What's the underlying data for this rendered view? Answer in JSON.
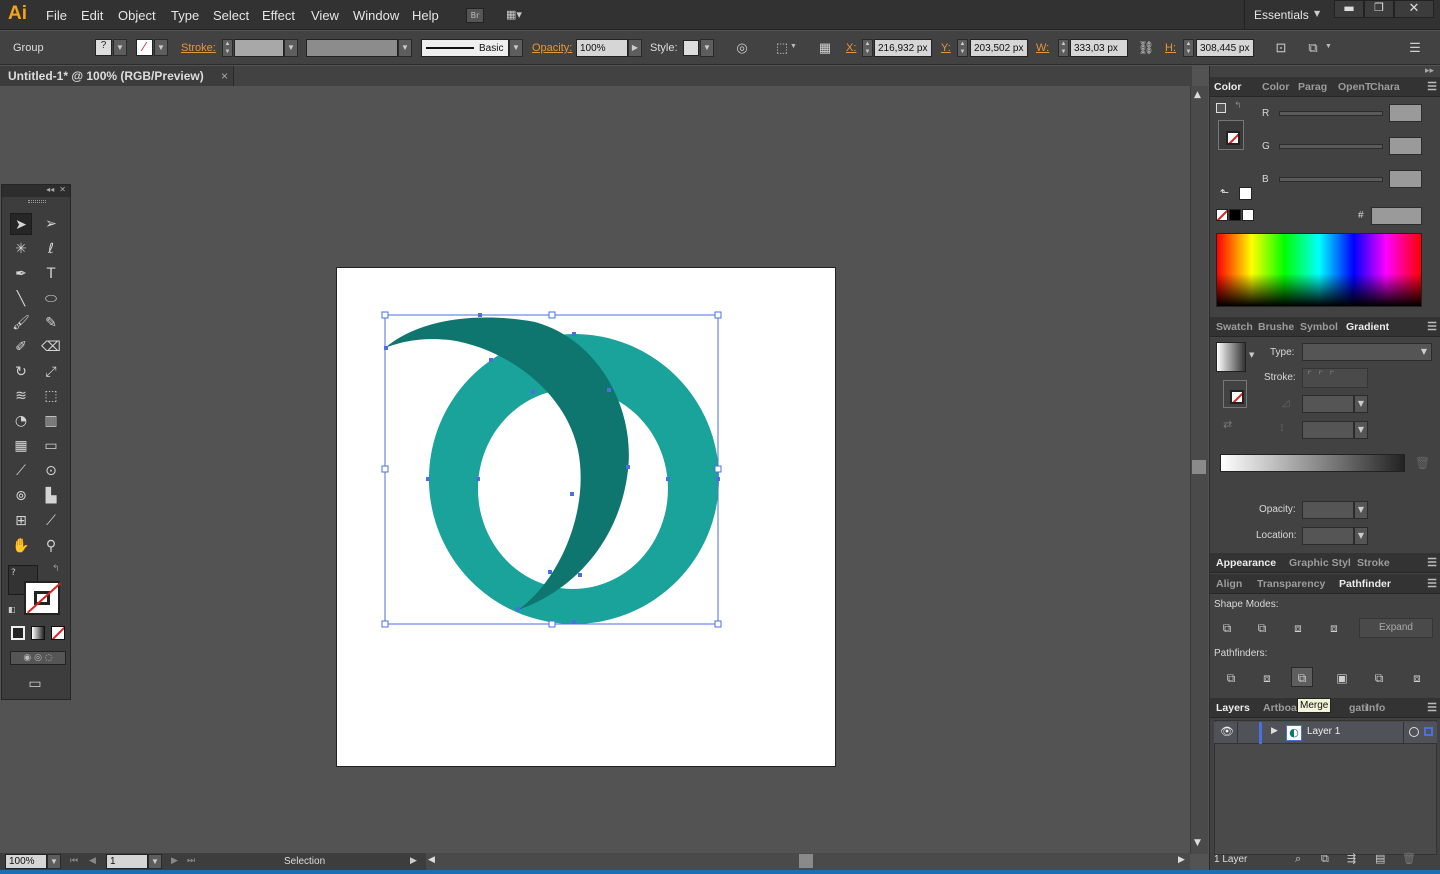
{
  "app": {
    "logo": "Ai"
  },
  "menu": [
    "File",
    "Edit",
    "Object",
    "Type",
    "Select",
    "Effect",
    "View",
    "Window",
    "Help"
  ],
  "bridge_label": "Br",
  "workspace": "Essentials",
  "control_bar": {
    "selection_type": "Group",
    "stroke_label": "Stroke:",
    "brush_label": "Basic",
    "opacity_label": "Opacity:",
    "opacity_value": "100%",
    "style_label": "Style:",
    "x_label": "X:",
    "x_value": "216,932 px",
    "y_label": "Y:",
    "y_value": "203,502 px",
    "w_label": "W:",
    "w_value": "333,03 px",
    "h_label": "H:",
    "h_value": "308,445 px"
  },
  "document_tab": {
    "title": "Untitled-1* @ 100% (RGB/Preview)",
    "close": "×"
  },
  "status": {
    "zoom": "100%",
    "artboard_num": "1",
    "tool": "Selection"
  },
  "color_panel": {
    "tabs": [
      "Color",
      "Color",
      "Parag",
      "OpenT",
      "Chara"
    ],
    "channels": [
      "R",
      "G",
      "B"
    ],
    "hex_label": "#"
  },
  "gradient_panel": {
    "tabs": [
      "Swatch",
      "Brushe",
      "Symbol",
      "Gradient"
    ],
    "type_label": "Type:",
    "stroke_label": "Stroke:",
    "opacity_label": "Opacity:",
    "location_label": "Location:"
  },
  "appearance_tabs": [
    "Appearance",
    "Graphic Styl",
    "Stroke"
  ],
  "pathfinder_panel": {
    "tabs": [
      "Align",
      "Transparency",
      "Pathfinder"
    ],
    "shape_modes_label": "Shape Modes:",
    "expand_label": "Expand",
    "pathfinders_label": "Pathfinders:",
    "tooltip": "Merge"
  },
  "layers_panel": {
    "tabs": [
      "Layers",
      "Artboa",
      "gati",
      "Info"
    ],
    "layer_name": "Layer 1",
    "count": "1 Layer"
  },
  "colors": {
    "ring": "#19a39a",
    "crescent": "#0e766f",
    "selection": "#4a6fe0"
  }
}
